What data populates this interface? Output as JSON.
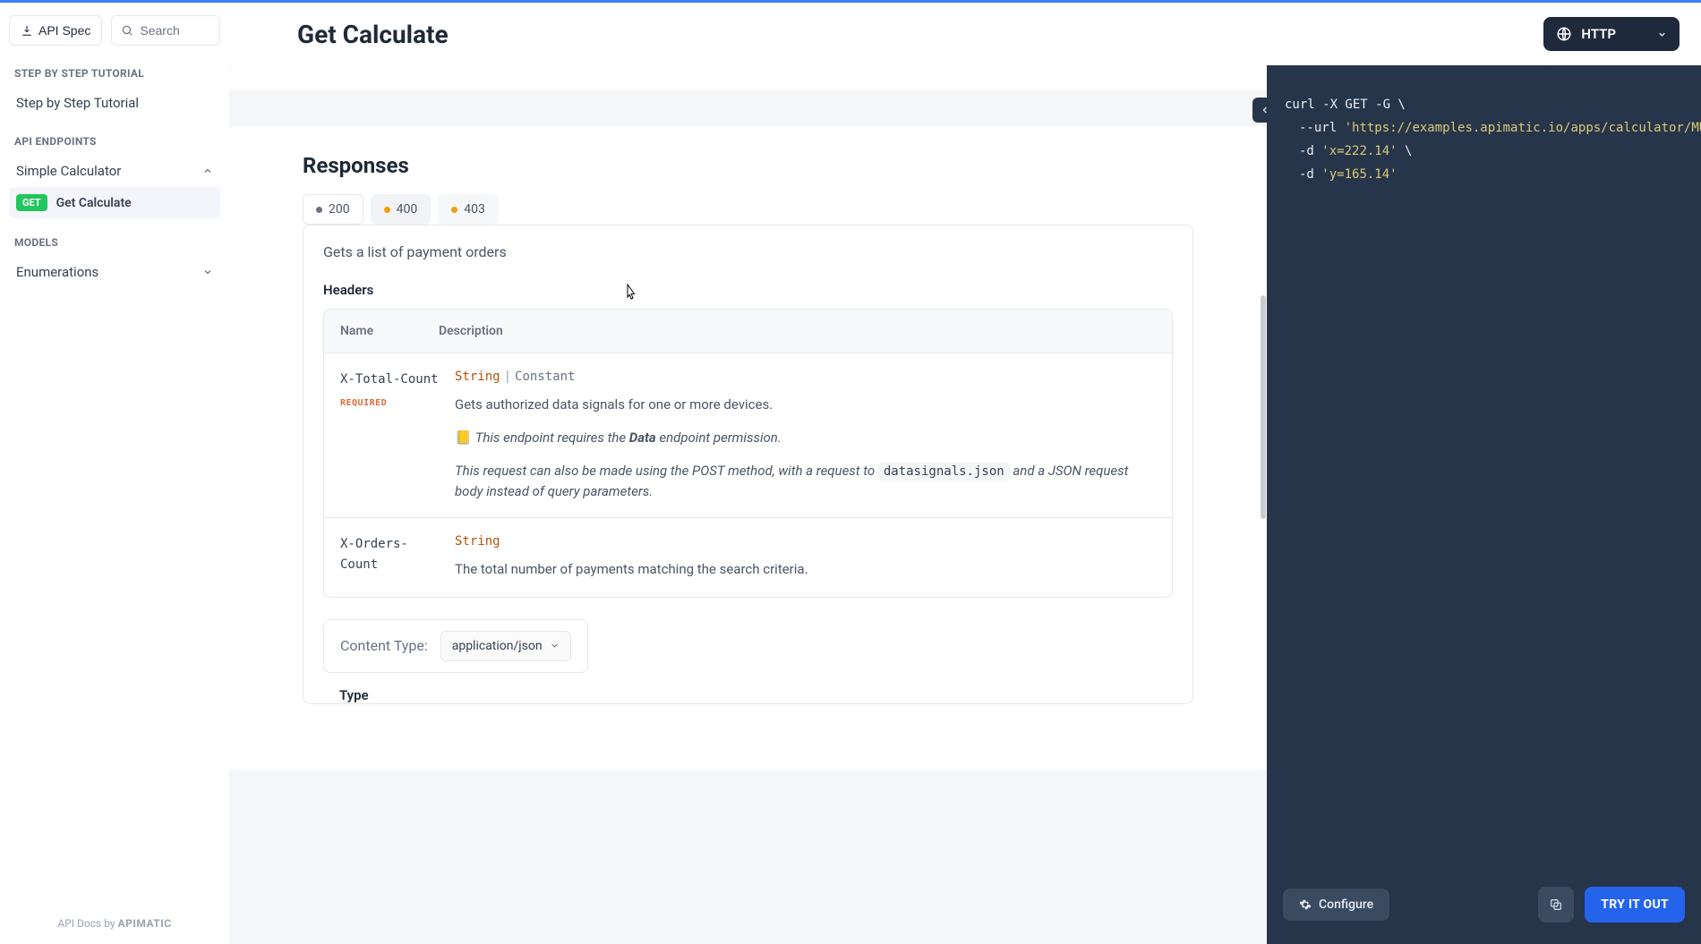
{
  "header": {
    "api_spec": "API Spec",
    "search_placeholder": "Search",
    "page_title": "Get Calculate",
    "protocol": "HTTP"
  },
  "sidebar": {
    "sections": {
      "tutorial_label": "STEP BY STEP TUTORIAL",
      "tutorial_item": "Step by Step Tutorial",
      "endpoints_label": "API ENDPOINTS",
      "endpoints_group": "Simple Calculator",
      "endpoint_method": "GET",
      "endpoint_name": "Get Calculate",
      "models_label": "MODELS",
      "models_item": "Enumerations"
    },
    "footer_prefix": "API Docs by ",
    "footer_brand": "APIMATIC"
  },
  "responses": {
    "title": "Responses",
    "tabs": [
      {
        "code": "200",
        "color": "gray"
      },
      {
        "code": "400",
        "color": "orange"
      },
      {
        "code": "403",
        "color": "orange"
      }
    ],
    "description": "Gets a list of payment orders",
    "headers_label": "Headers",
    "table": {
      "col_name": "Name",
      "col_desc": "Description",
      "rows": [
        {
          "name": "X-Total-Count",
          "required": "REQUIRED",
          "type_primary": "String",
          "type_secondary": "Constant",
          "desc": "Gets authorized data signals for one or more devices.",
          "note_prefix": "This endpoint requires the ",
          "note_bold": "Data",
          "note_suffix": " endpoint permission.",
          "note2_prefix": "This request can also be made using the POST method, with a request to ",
          "note2_code": "datasignals.json",
          "note2_suffix": " and a JSON request body instead of query parameters."
        },
        {
          "name": "X-Orders-Count",
          "type_primary": "String",
          "desc": "The total number of payments matching the search criteria."
        }
      ]
    },
    "content_type_label": "Content Type:",
    "content_type_value": "application/json",
    "type_label": "Type"
  },
  "code": {
    "line1_cmd": "curl -X GET -G \\",
    "line2_flag": "--url",
    "line2_str": "'https://examples.apimatic.io/apps/calculator/MULTIPLY'",
    "line3_flag": "-d",
    "line3_str": "'x=222.14'",
    "line3_tail": " \\",
    "line4_flag": "-d",
    "line4_str": "'y=165.14'",
    "configure": "Configure",
    "try": "TRY IT OUT"
  }
}
